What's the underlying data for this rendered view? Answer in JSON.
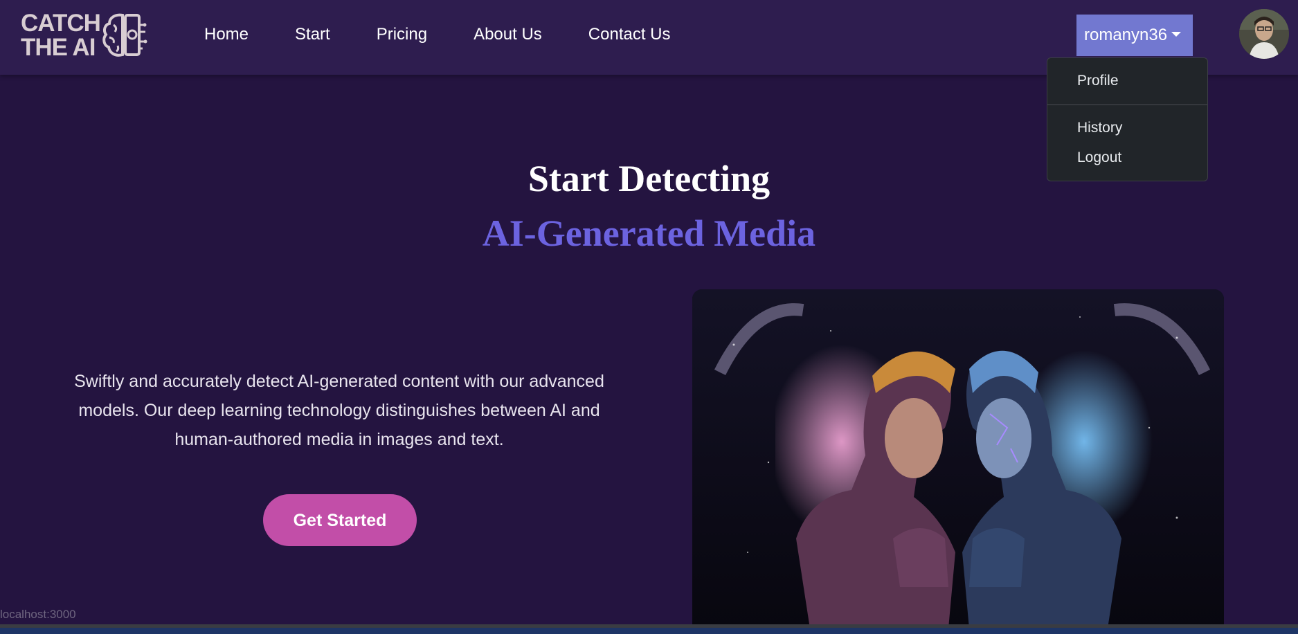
{
  "logo": {
    "line1": "CATCH",
    "line2": "THE AI"
  },
  "nav": {
    "links": [
      {
        "label": "Home"
      },
      {
        "label": "Start"
      },
      {
        "label": "Pricing"
      },
      {
        "label": "About Us"
      },
      {
        "label": "Contact Us"
      }
    ]
  },
  "user": {
    "name": "romanyn36",
    "menu": [
      {
        "label": "Profile"
      },
      {
        "label": "History"
      },
      {
        "label": "Logout"
      }
    ]
  },
  "hero": {
    "title": "Start Detecting",
    "subtitle": "AI-Generated Media",
    "description": "Swiftly and accurately detect AI-generated content with our advanced models. Our deep learning technology distinguishes between AI and human-authored media in images and text.",
    "cta_label": "Get Started"
  },
  "status_bar": {
    "url": "localhost:3000"
  },
  "colors": {
    "background": "#241440",
    "navbar": "#2e1d4f",
    "accent": "#6c63e0",
    "user_button": "#7278d0",
    "cta": "#c24ea8",
    "dropdown": "#212529"
  }
}
